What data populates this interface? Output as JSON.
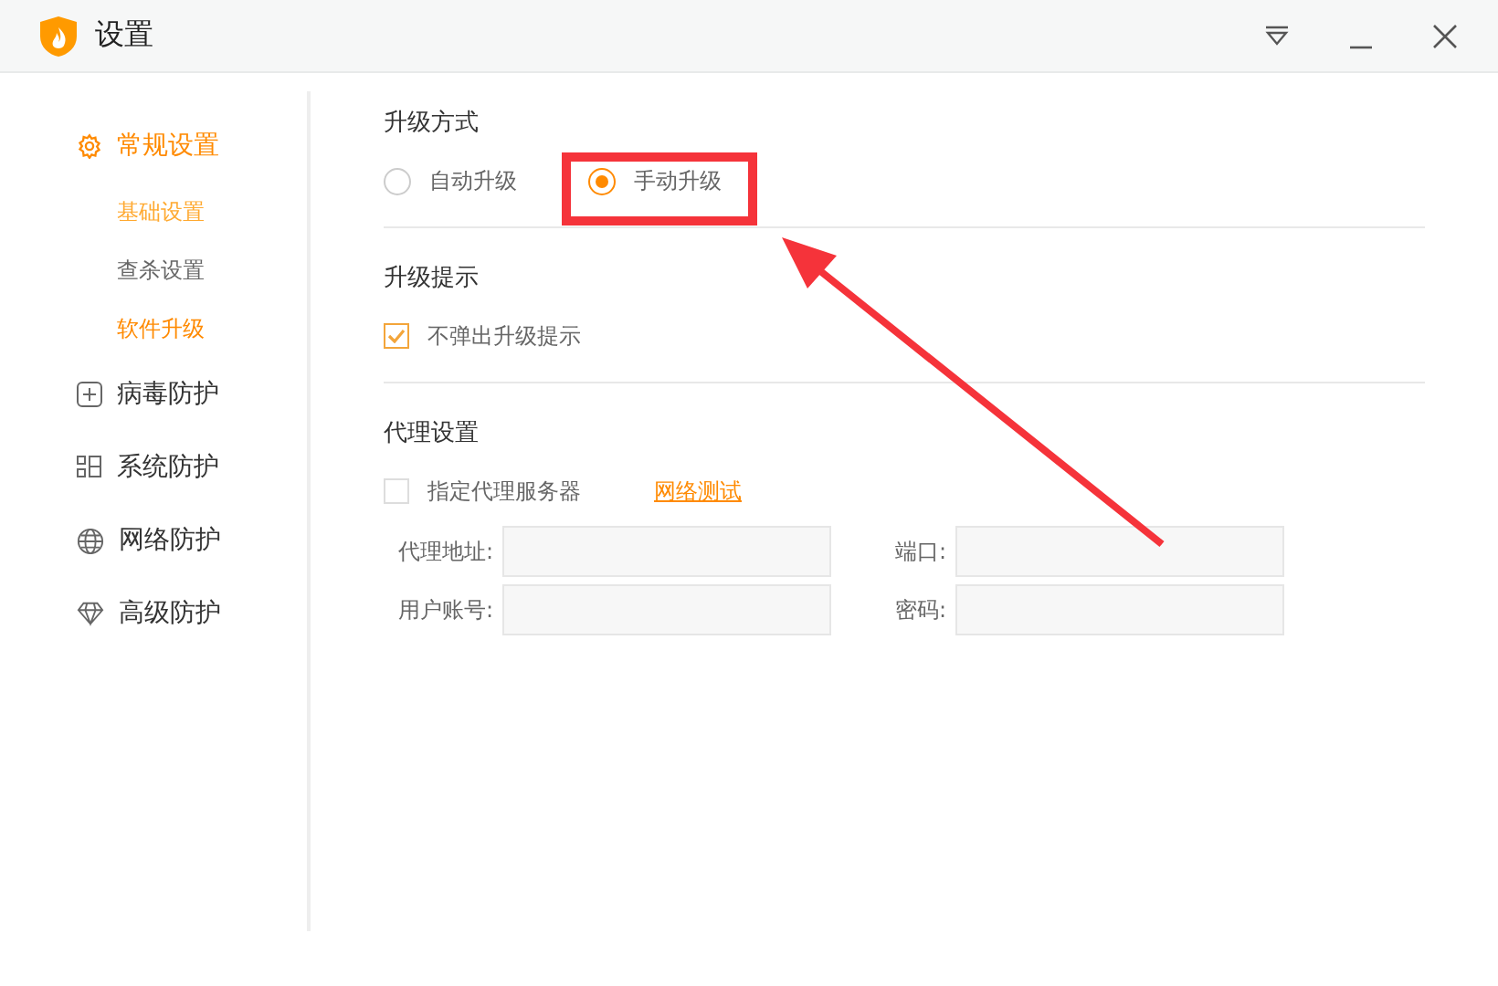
{
  "window": {
    "title": "设置"
  },
  "sidebar": {
    "items": [
      {
        "label": "常规设置",
        "selected": true,
        "children": [
          {
            "label": "基础设置",
            "selected": false,
            "hovered": true
          },
          {
            "label": "查杀设置",
            "selected": false,
            "hovered": false
          },
          {
            "label": "软件升级",
            "selected": true,
            "hovered": false
          }
        ]
      },
      {
        "label": "病毒防护",
        "selected": false
      },
      {
        "label": "系统防护",
        "selected": false
      },
      {
        "label": "网络防护",
        "selected": false
      },
      {
        "label": "高级防护",
        "selected": false
      }
    ]
  },
  "upgrade_mode": {
    "title": "升级方式",
    "options": [
      {
        "label": "自动升级",
        "selected": false
      },
      {
        "label": "手动升级",
        "selected": true
      }
    ]
  },
  "upgrade_notice": {
    "title": "升级提示",
    "checkbox": {
      "label": "不弹出升级提示",
      "checked": true
    }
  },
  "proxy": {
    "title": "代理设置",
    "checkbox": {
      "label": "指定代理服务器",
      "checked": false
    },
    "link": "网络测试",
    "fields": [
      {
        "label": "代理地址:"
      },
      {
        "label": "端口:"
      },
      {
        "label": "用户账号:"
      },
      {
        "label": "密码:"
      }
    ]
  }
}
